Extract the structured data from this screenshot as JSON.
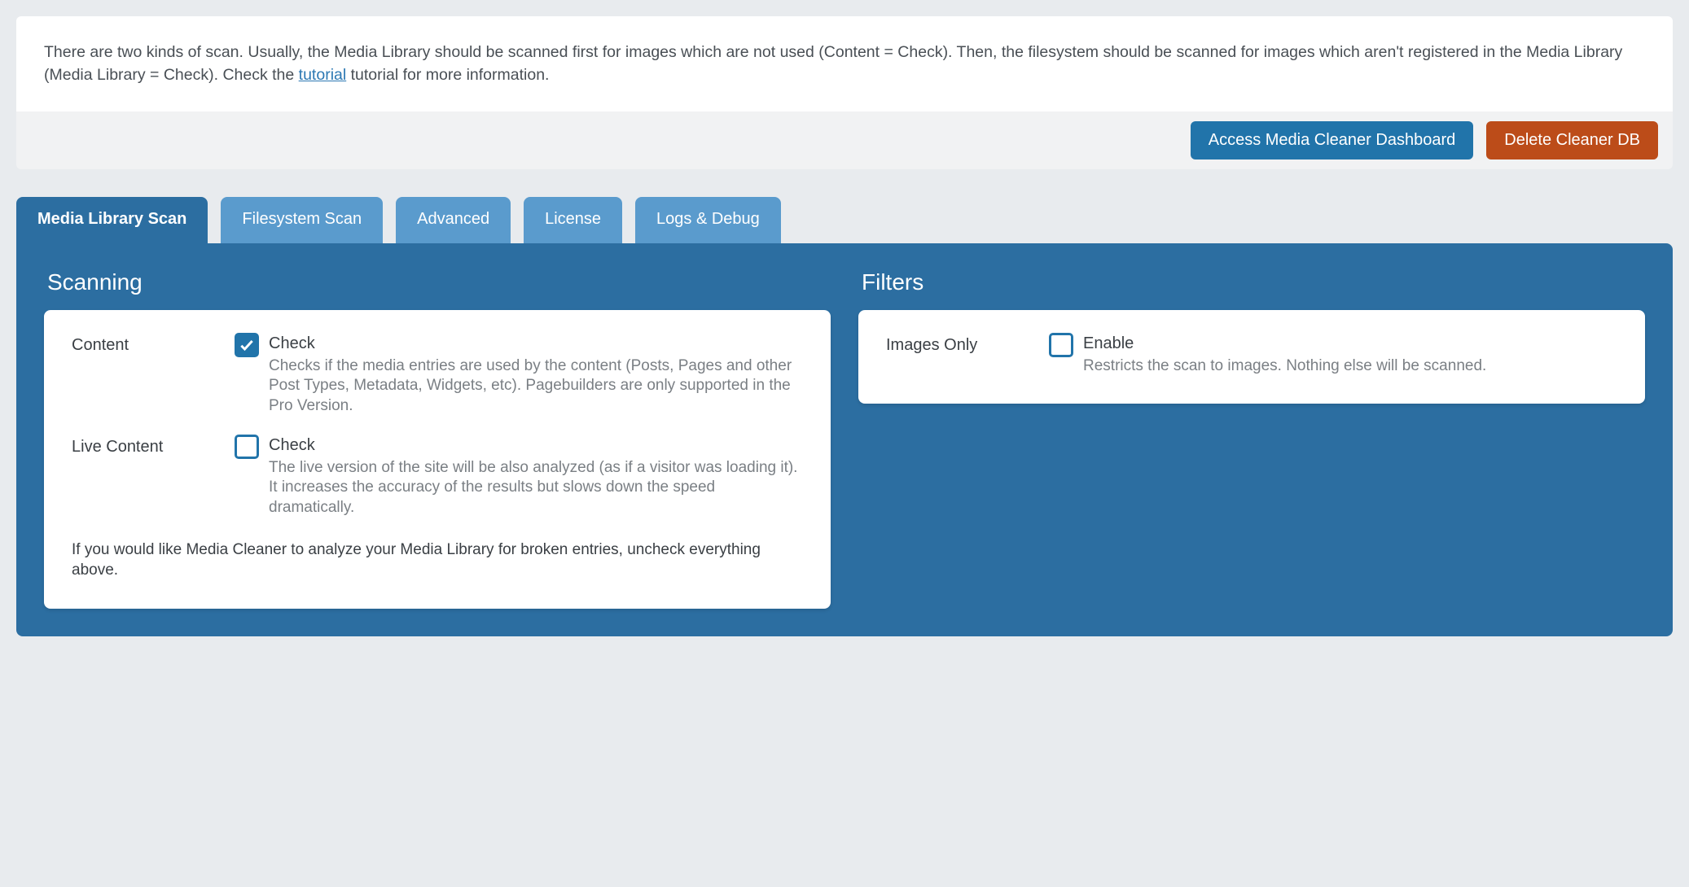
{
  "info": {
    "text_a": "There are two kinds of scan. Usually, the Media Library should be scanned first for images which are not used (Content = Check). Then, the filesystem should be scanned for images which aren't registered in the Media Library (Media Library = Check). Check the ",
    "link": "tutorial",
    "text_b": " tutorial for more information."
  },
  "actions": {
    "dashboard": "Access Media Cleaner Dashboard",
    "delete_db": "Delete Cleaner DB"
  },
  "tabs": [
    {
      "label": "Media Library Scan",
      "active": true
    },
    {
      "label": "Filesystem Scan",
      "active": false
    },
    {
      "label": "Advanced",
      "active": false
    },
    {
      "label": "License",
      "active": false
    },
    {
      "label": "Logs & Debug",
      "active": false
    }
  ],
  "scanning": {
    "title": "Scanning",
    "content": {
      "row_label": "Content",
      "check_label": "Check",
      "checked": true,
      "desc": "Checks if the media entries are used by the content (Posts, Pages and other Post Types, Metadata, Widgets, etc). Pagebuilders are only supported in the Pro Version."
    },
    "live_content": {
      "row_label": "Live Content",
      "check_label": "Check",
      "checked": false,
      "desc": "The live version of the site will be also analyzed (as if a visitor was loading it). It increases the accuracy of the results but slows down the speed dramatically."
    },
    "footnote": "If you would like Media Cleaner to analyze your Media Library for broken entries, uncheck everything above."
  },
  "filters": {
    "title": "Filters",
    "images_only": {
      "row_label": "Images Only",
      "check_label": "Enable",
      "checked": false,
      "desc": "Restricts the scan to images. Nothing else will be scanned."
    }
  }
}
